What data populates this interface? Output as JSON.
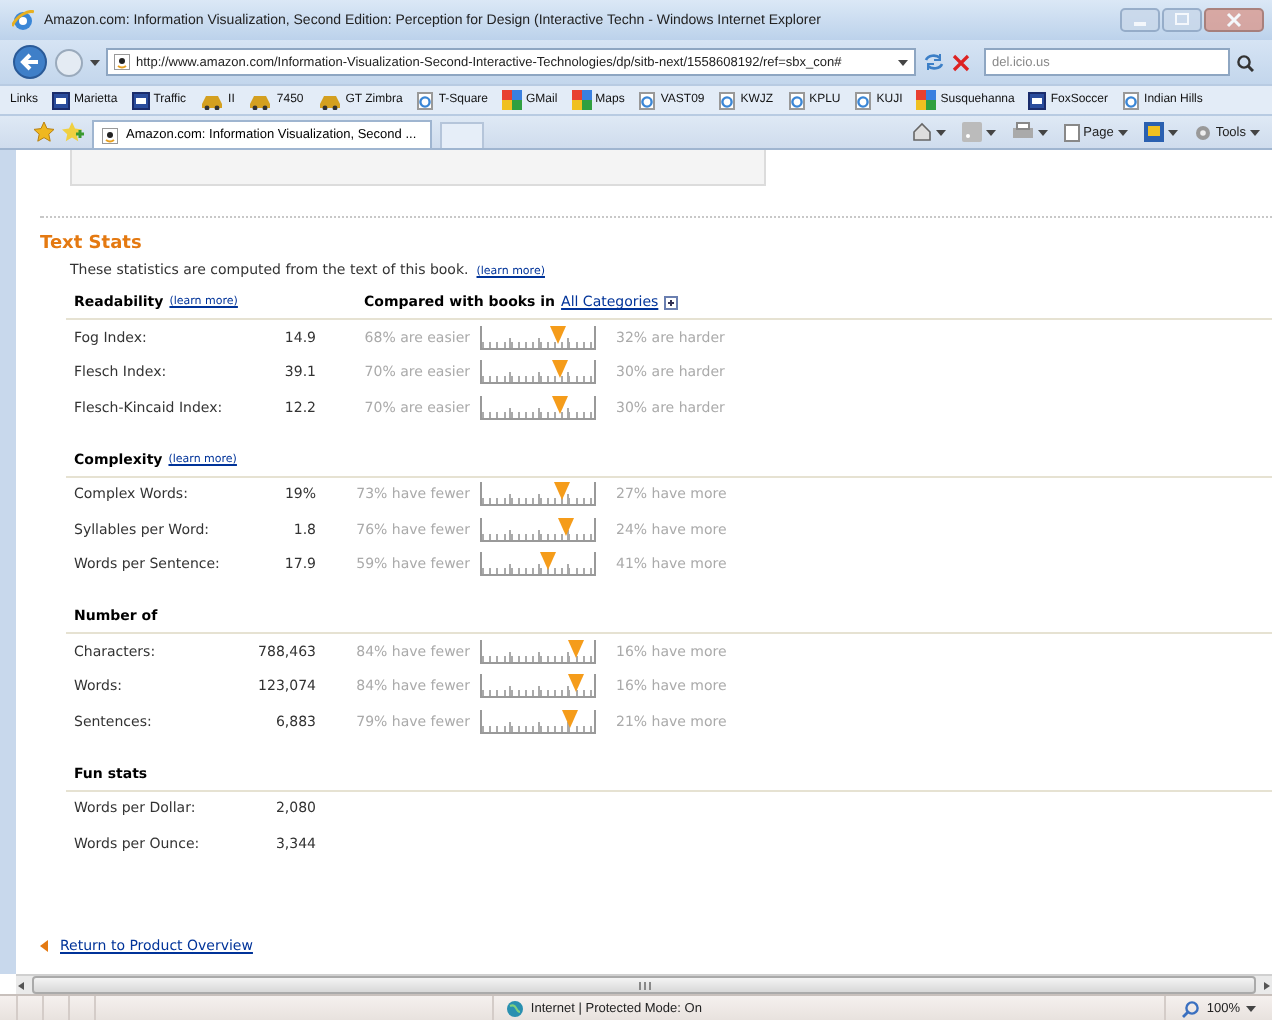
{
  "window": {
    "title": "Amazon.com: Information Visualization, Second Edition: Perception for Design (Interactive Techn - Windows Internet Explorer"
  },
  "address_bar": {
    "url": "http://www.amazon.com/Information-Visualization-Second-Interactive-Technologies/dp/sitb-next/1558608192/ref=sbx_con#",
    "search_placeholder": "del.icio.us"
  },
  "links_bar": {
    "label": "Links",
    "items": [
      {
        "label": "Marietta",
        "kind": "box"
      },
      {
        "label": "Traffic",
        "kind": "box"
      },
      {
        "label": "II",
        "kind": "car"
      },
      {
        "label": "7450",
        "kind": "car"
      },
      {
        "label": "GT Zimbra",
        "kind": "car"
      },
      {
        "label": "T-Square",
        "kind": "page"
      },
      {
        "label": "GMail",
        "kind": "tiles"
      },
      {
        "label": "Maps",
        "kind": "tiles"
      },
      {
        "label": "VAST09",
        "kind": "page"
      },
      {
        "label": "KWJZ",
        "kind": "page"
      },
      {
        "label": "KPLU",
        "kind": "page"
      },
      {
        "label": "KUJI",
        "kind": "page"
      },
      {
        "label": "Susquehanna",
        "kind": "tiles"
      },
      {
        "label": "FoxSoccer",
        "kind": "box"
      },
      {
        "label": "Indian Hills",
        "kind": "page"
      }
    ]
  },
  "tab": {
    "title": "Amazon.com: Information Visualization, Second ..."
  },
  "command_bar": {
    "page": "Page",
    "tools": "Tools"
  },
  "text_stats": {
    "title": "Text Stats",
    "intro": "These statistics are computed from the text of this book.",
    "intro_link": "(learn more)",
    "sections": [
      {
        "heading": "Readability",
        "link": "(learn more)",
        "compare_text": "Compared with books in",
        "compare_link": "All Categories",
        "rows": [
          {
            "label": "Fog Index:",
            "value": "14.9",
            "lower": "68% are easier",
            "level": 0.68,
            "upper": "32% are harder"
          },
          {
            "label": "Flesch Index:",
            "value": "39.1",
            "lower": "70% are easier",
            "level": 0.7,
            "upper": "30% are harder"
          },
          {
            "label": "Flesch-Kincaid Index:",
            "value": "12.2",
            "lower": "70% are easier",
            "level": 0.7,
            "upper": "30% are harder"
          }
        ]
      },
      {
        "heading": "Complexity",
        "link": "(learn more)",
        "rows": [
          {
            "label": "Complex Words:",
            "value": "19%",
            "lower": "73% have fewer",
            "level": 0.73,
            "upper": "27% have more"
          },
          {
            "label": "Syllables per Word:",
            "value": "1.8",
            "lower": "76% have fewer",
            "level": 0.76,
            "upper": "24% have more"
          },
          {
            "label": "Words per Sentence:",
            "value": "17.9",
            "lower": "59% have fewer",
            "level": 0.59,
            "upper": "41% have more"
          }
        ]
      },
      {
        "heading": "Number of",
        "rows": [
          {
            "label": "Characters:",
            "value": "788,463",
            "lower": "84% have fewer",
            "level": 0.84,
            "upper": "16% have more"
          },
          {
            "label": "Words:",
            "value": "123,074",
            "lower": "84% have fewer",
            "level": 0.84,
            "upper": "16% have more"
          },
          {
            "label": "Sentences:",
            "value": "6,883",
            "lower": "79% have fewer",
            "level": 0.79,
            "upper": "21% have more"
          }
        ]
      },
      {
        "heading": "Fun stats",
        "rows": [
          {
            "label": "Words per Dollar:",
            "value": "2,080"
          },
          {
            "label": "Words per Ounce:",
            "value": "3,344"
          }
        ]
      }
    ]
  },
  "return_link": "Return to Product Overview",
  "status_bar": {
    "zone": "Internet | Protected Mode: On",
    "zoom": "100%"
  }
}
